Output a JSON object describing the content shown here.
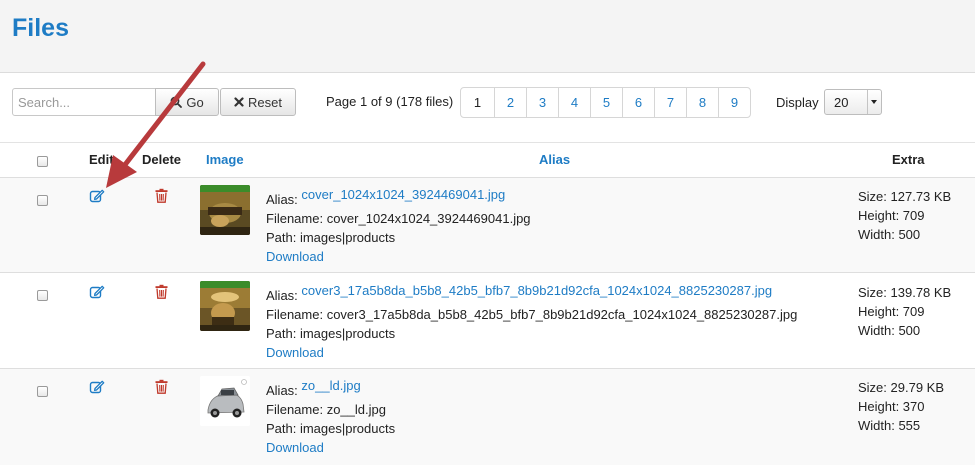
{
  "page_title": "Files",
  "search": {
    "placeholder": "Search...",
    "go_label": "Go",
    "reset_label": "Reset"
  },
  "pagination": {
    "info": "Page 1 of 9 (178 files)",
    "pages": [
      "1",
      "2",
      "3",
      "4",
      "5",
      "6",
      "7",
      "8",
      "9"
    ],
    "current": "1"
  },
  "display": {
    "label": "Display",
    "value": "20"
  },
  "table": {
    "headers": {
      "edit": "Edit",
      "delete": "Delete",
      "image": "Image",
      "alias": "Alias",
      "extra": "Extra"
    },
    "rows": [
      {
        "alias_label": "Alias:",
        "alias": "cover_1024x1024_3924469041.jpg",
        "filename": "Filename: cover_1024x1024_3924469041.jpg",
        "path": "Path: images|products",
        "download": "Download",
        "size": "Size: 127.73 KB",
        "height": "Height: 709",
        "width": "Width: 500"
      },
      {
        "alias_label": "Alias:",
        "alias": "cover3_17a5b8da_b5b8_42b5_bfb7_8b9b21d92cfa_1024x1024_8825230287.jpg",
        "filename": "Filename: cover3_17a5b8da_b5b8_42b5_bfb7_8b9b21d92cfa_1024x1024_8825230287.jpg",
        "path": "Path: images|products",
        "download": "Download",
        "size": "Size: 139.78 KB",
        "height": "Height: 709",
        "width": "Width: 500"
      },
      {
        "alias_label": "Alias:",
        "alias": "zo__ld.jpg",
        "filename": "Filename: zo__ld.jpg",
        "path": "Path: images|products",
        "download": "Download",
        "size": "Size: 29.79 KB",
        "height": "Height: 370",
        "width": "Width: 555"
      }
    ]
  },
  "colors": {
    "accent": "#1e7cc5",
    "delete": "#c0392b",
    "annotation_arrow": "#c0393b"
  }
}
